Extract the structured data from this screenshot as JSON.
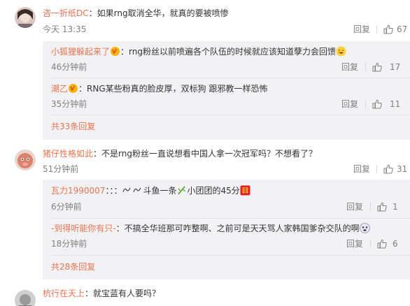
{
  "actions": {
    "reply": "回复"
  },
  "comments": [
    {
      "user": "咨一折纸DC",
      "text": "：如果rng取消全华，就真的要被喷惨",
      "time": "今天 13:35",
      "likes": "67",
      "replies": [
        {
          "user": "小狐狸躲起来了",
          "text": "：rng粉丝以前喷遍各个队伍的时候就应该知道孽力会回馈",
          "time": "46分钟前",
          "likes": "17"
        },
        {
          "user": "潮乙",
          "text": "：RNG某些粉真的脸皮厚，双标狗 跟邪教一样恐怖",
          "time": "35分钟前",
          "likes": "11"
        }
      ],
      "more": "共33条回复"
    },
    {
      "user": "猪仔性格如此",
      "text": "：不是rng粉丝一直说想看中国人拿一次冠军吗？不想看了？",
      "time": "51分钟前",
      "likes": "31",
      "replies": [
        {
          "user": "瓦力1990007",
          "text_a": "：：：",
          "text_b": "斗鱼一条",
          "text_c": "小团团的45分",
          "time": "6分钟前",
          "likes": "1"
        },
        {
          "user": "-到得听能你有只-",
          "text": "：不搞全华班那可咋整啊、之前可是天天骂人家韩国爹杂交队的啊",
          "time": "18分钟前",
          "likes": "6"
        }
      ],
      "more": "共28条回复"
    },
    {
      "user": "杭行在天上",
      "text": "：就宝蓝有人要吗？",
      "time": "",
      "likes": ""
    }
  ]
}
